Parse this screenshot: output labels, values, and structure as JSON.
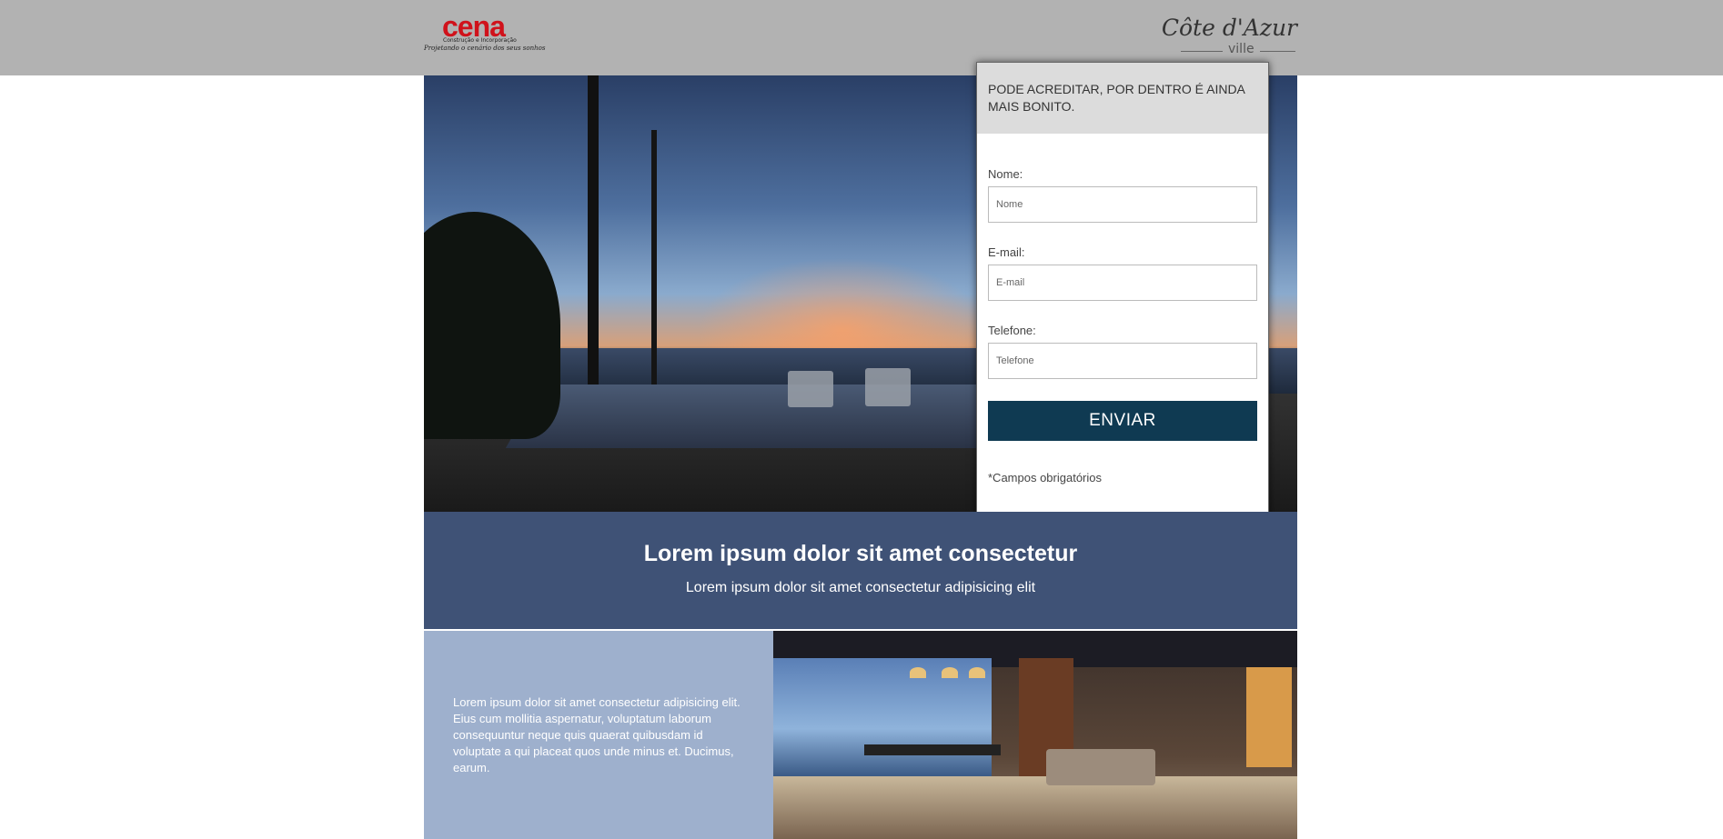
{
  "header": {
    "brand_left": {
      "name": "cena",
      "subtitle": "Construção e Incorporação",
      "tagline": "Projetando o cenário dos seus sonhos"
    },
    "brand_right": {
      "name": "Côte d'Azur",
      "suffix": "ville"
    }
  },
  "form": {
    "heading": "PODE ACREDITAR, POR DENTRO É AINDA MAIS BONITO.",
    "fields": [
      {
        "label": "Nome:",
        "placeholder": "Nome"
      },
      {
        "label": "E-mail:",
        "placeholder": "E-mail"
      },
      {
        "label": "Telefone:",
        "placeholder": "Telefone"
      }
    ],
    "submit_label": "ENVIAR",
    "required_note": "*Campos obrigatórios"
  },
  "band": {
    "title": "Lorem ipsum dolor sit amet consectetur",
    "subtitle": "Lorem ipsum dolor sit amet consectetur adipisicing elit"
  },
  "feature": {
    "text": "Lorem ipsum dolor sit amet consectetur adipisicing elit. Eius cum mollitia aspernatur, voluptatum laborum consequuntur neque quis quaerat quibusdam id voluptate a qui placeat quos unde minus et. Ducimus, earum."
  },
  "colors": {
    "header_bg": "#b2b2b2",
    "band_bg": "#3f5276",
    "panel_bg": "#9eb0cd",
    "submit_bg": "#0f3a52",
    "brand_red": "#d0121b"
  }
}
